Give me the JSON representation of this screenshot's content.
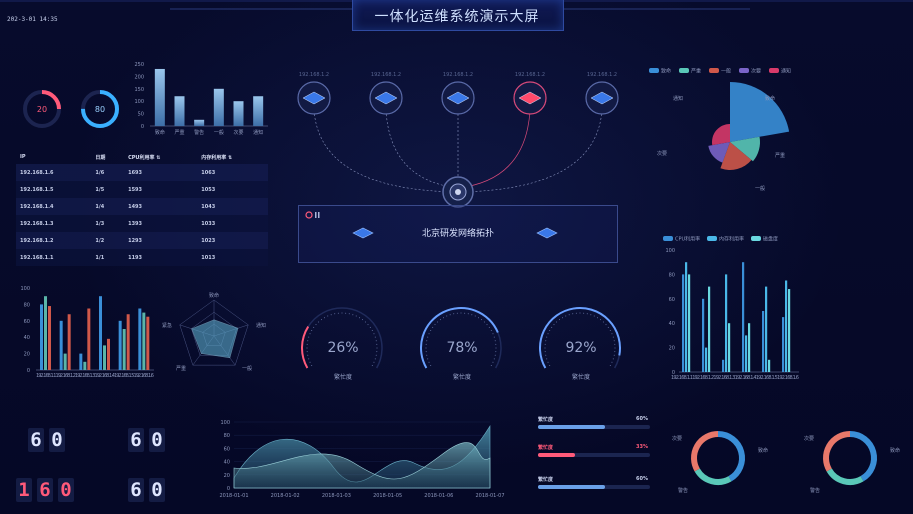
{
  "header": {
    "title": "一体化运维系统演示大屏",
    "clock": "202-3-01 14:35"
  },
  "donuts_small": [
    {
      "value": "20",
      "fraction": 0.25,
      "color": "#ff5a7a"
    },
    {
      "value": "80",
      "fraction": 0.75,
      "color": "#3ab0ff"
    }
  ],
  "alarm_bars": {
    "type": "bar",
    "categories": [
      "致命",
      "严重",
      "警告",
      "一般",
      "次要",
      "通知"
    ],
    "values": [
      230,
      120,
      25,
      150,
      100,
      120
    ],
    "yticks": [
      "250",
      "200",
      "150",
      "100",
      "50",
      "0"
    ],
    "ylim": [
      0,
      250
    ]
  },
  "ip_table": {
    "headers": [
      "IP",
      "日期",
      "CPU利用率 ⇅",
      "内存利用率 ⇅"
    ],
    "rows": [
      [
        "192.168.1.6",
        "1/6",
        "1693",
        "1063"
      ],
      [
        "192.168.1.5",
        "1/5",
        "1593",
        "1053"
      ],
      [
        "192.168.1.4",
        "1/4",
        "1493",
        "1043"
      ],
      [
        "192.168.1.3",
        "1/3",
        "1393",
        "1033"
      ],
      [
        "192.168.1.2",
        "1/2",
        "1293",
        "1023"
      ],
      [
        "192.168.1.1",
        "1/1",
        "1193",
        "1013"
      ]
    ]
  },
  "topology": {
    "title": "北京研发网络拓扑",
    "nodes": [
      {
        "ip": "192.168.1.2",
        "alert": false
      },
      {
        "ip": "192.168.1.2",
        "alert": false
      },
      {
        "ip": "192.168.1.2",
        "alert": false
      },
      {
        "ip": "192.168.1.2",
        "alert": true
      },
      {
        "ip": "192.168.1.2",
        "alert": false
      }
    ]
  },
  "rose_chart": {
    "type": "pie",
    "legend": [
      {
        "name": "致命",
        "color": "#3a8fd8"
      },
      {
        "name": "严重",
        "color": "#5ac8b8"
      },
      {
        "name": "一般",
        "color": "#d0584a"
      },
      {
        "name": "次要",
        "color": "#7a64c8"
      },
      {
        "name": "通知",
        "color": "#d83a6a"
      }
    ],
    "labels": [
      "致命",
      "严重",
      "一般",
      "次要",
      "通知"
    ]
  },
  "multi_bar": {
    "type": "bar",
    "yticks": [
      "100",
      "80",
      "60",
      "40",
      "20",
      "0"
    ],
    "xlabel_text": "192.168.1.1192.168.1.2192.168.1.3192.168.1.4192.168.1.5192.168.1.6",
    "series": [
      {
        "color": "#3a8fd8",
        "values": [
          80,
          60,
          20,
          90,
          60,
          75
        ]
      },
      {
        "color": "#5ab4a8",
        "values": [
          90,
          20,
          10,
          30,
          50,
          70
        ]
      },
      {
        "color": "#d0584a",
        "values": [
          78,
          68,
          75,
          38,
          68,
          65
        ]
      }
    ]
  },
  "radar": {
    "labels": [
      "致命",
      "通知",
      "一般",
      "严重",
      "紧急"
    ]
  },
  "gauges": [
    {
      "value": "26%",
      "fraction": 0.26,
      "label": "繁忙度",
      "color": "#ff5a7a"
    },
    {
      "value": "78%",
      "fraction": 0.78,
      "label": "繁忙度",
      "color": "#6aa0ff"
    },
    {
      "value": "92%",
      "fraction": 0.92,
      "label": "繁忙度",
      "color": "#6aa0ff"
    }
  ],
  "right_bars": {
    "type": "bar",
    "legend": [
      {
        "name": "CPU利用率",
        "color": "#3a8fd8"
      },
      {
        "name": "内存利用率",
        "color": "#4ab8e8"
      },
      {
        "name": "磁盘度",
        "color": "#6ad8e0"
      }
    ],
    "yticks": [
      "100",
      "80",
      "60",
      "40",
      "20",
      "0"
    ],
    "xlabel_text": "192.168.1.1192.168.1.2192.168.1.3192.168.1.4192.168.1.5192.168.1.6",
    "values": [
      80,
      90,
      80,
      60,
      20,
      70,
      10,
      80,
      40,
      90,
      30,
      40,
      50,
      70,
      10,
      45,
      75,
      68
    ]
  },
  "counters": [
    {
      "digits": [
        "6",
        "0"
      ],
      "red": false
    },
    {
      "digits": [
        "6",
        "0"
      ],
      "red": false
    },
    {
      "digits": [
        "1",
        "6",
        "0"
      ],
      "red": true
    },
    {
      "digits": [
        "6",
        "0"
      ],
      "red": false
    }
  ],
  "area_chart": {
    "type": "area",
    "yticks": [
      "100",
      "80",
      "60",
      "40",
      "20",
      "0"
    ],
    "x": [
      "2018-01-01",
      "2018-01-02",
      "2018-01-03",
      "2018-01-05",
      "2018-01-06",
      "2018-01-07"
    ]
  },
  "progress": [
    {
      "label": "繁忙度",
      "value": "60%",
      "fraction": 0.6,
      "color": "#6aa0e8"
    },
    {
      "label": "繁忙度",
      "value": "33%",
      "fraction": 0.33,
      "color": "#ff5a7a"
    },
    {
      "label": "繁忙度",
      "value": "60%",
      "fraction": 0.6,
      "color": "#6aa0e8"
    }
  ],
  "ring_charts": [
    {
      "labels": [
        "次要",
        "致命",
        "警告"
      ]
    },
    {
      "labels": [
        "次要",
        "致命",
        "警告"
      ]
    }
  ]
}
